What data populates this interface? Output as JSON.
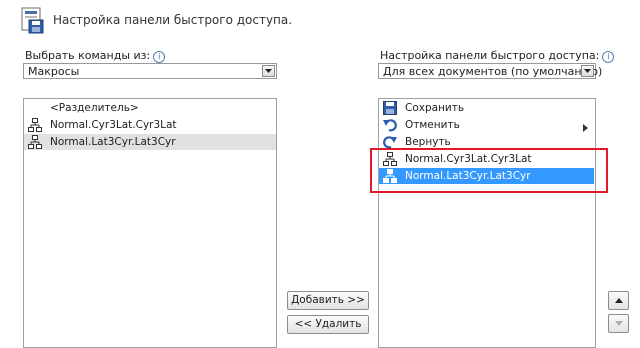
{
  "header": {
    "title": "Настройка панели быстрого доступа."
  },
  "left": {
    "label": "Выбрать команды из:",
    "dropdown_value": "Макросы",
    "items": [
      {
        "label": "<Разделитель>"
      },
      {
        "label": "Normal.Cyr3Lat.Cyr3Lat"
      },
      {
        "label": "Normal.Lat3Cyr.Lat3Cyr"
      }
    ]
  },
  "right": {
    "label": "Настройка панели быстрого доступа:",
    "dropdown_value": "Для всех документов (по умолчанию)",
    "items": [
      {
        "label": "Сохранить",
        "icon": "save-icon"
      },
      {
        "label": "Отменить",
        "icon": "undo-icon"
      },
      {
        "label": "Вернуть",
        "icon": "redo-icon"
      },
      {
        "label": "Normal.Cyr3Lat.Cyr3Lat",
        "icon": "macro-icon"
      },
      {
        "label": "Normal.Lat3Cyr.Lat3Cyr",
        "icon": "macro-icon"
      }
    ]
  },
  "buttons": {
    "add": "Добавить >>",
    "remove": "<< Удалить"
  },
  "colors": {
    "selection": "#3399ff",
    "highlight_box": "#e3172a"
  }
}
